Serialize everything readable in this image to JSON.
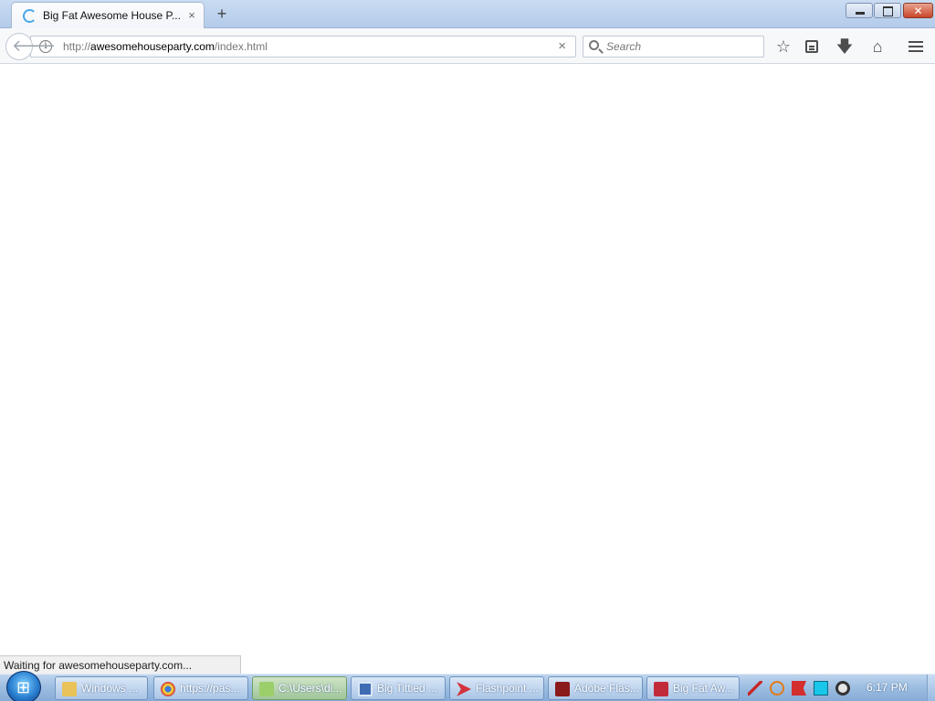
{
  "browser": {
    "tab": {
      "title": "Big Fat Awesome House P...",
      "close": "×"
    },
    "new_tab": "+",
    "url": {
      "scheme": "http://",
      "host": "awesomehouseparty.com",
      "path": "/index.html"
    },
    "url_stop": "×",
    "search": {
      "placeholder": "Search"
    },
    "status": "Waiting for awesomehouseparty.com..."
  },
  "taskbar": {
    "items": [
      {
        "label": "Windows ...",
        "icon": "folder-icon",
        "color": "#e9c25a"
      },
      {
        "label": "https://pas...",
        "icon": "chrome-icon",
        "color": "#d94a38"
      },
      {
        "label": "C:\\Users\\di...",
        "icon": "notepad-icon",
        "color": "#9ccf6b"
      },
      {
        "label": "Big Tittied ...",
        "icon": "window-icon",
        "color": "#3e6db3"
      },
      {
        "label": "Flashpoint ...",
        "icon": "flashpoint-icon",
        "color": "#d3343d"
      },
      {
        "label": "Adobe Flas...",
        "icon": "adobe-flash-icon",
        "color": "#8b1a1a"
      },
      {
        "label": "Big Fat Aw...",
        "icon": "flash-projector-icon",
        "color": "#c22b3a"
      }
    ],
    "clock": "6:17 PM"
  }
}
